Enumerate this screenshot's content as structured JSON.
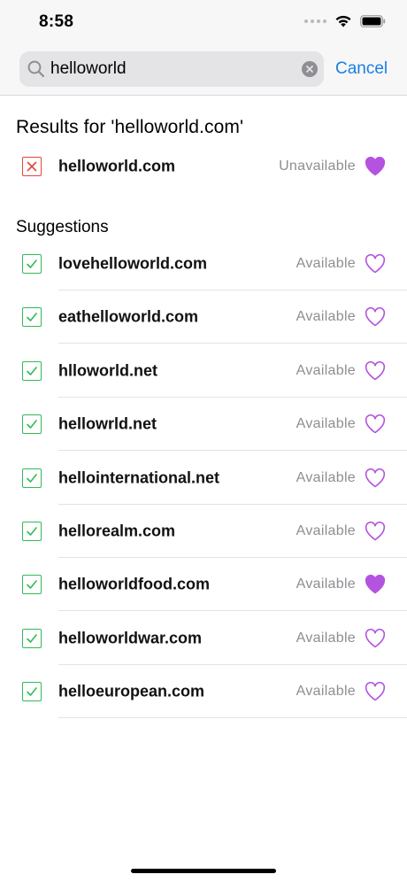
{
  "status_bar": {
    "time": "8:58"
  },
  "search": {
    "query": "helloworld",
    "cancel_label": "Cancel"
  },
  "results": {
    "title": "Results for 'helloworld.com'",
    "item": {
      "domain": "helloworld.com",
      "status": "Unavailable",
      "favorited": true,
      "available": false
    }
  },
  "suggestions": {
    "title": "Suggestions",
    "items": [
      {
        "domain": "lovehelloworld.com",
        "status": "Available",
        "favorited": false
      },
      {
        "domain": "eathelloworld.com",
        "status": "Available",
        "favorited": false
      },
      {
        "domain": "hlloworld.net",
        "status": "Available",
        "favorited": false
      },
      {
        "domain": "hellowrld.net",
        "status": "Available",
        "favorited": false
      },
      {
        "domain": "hellointernational.net",
        "status": "Available",
        "favorited": false
      },
      {
        "domain": "hellorealm.com",
        "status": "Available",
        "favorited": false
      },
      {
        "domain": "helloworldfood.com",
        "status": "Available",
        "favorited": true
      },
      {
        "domain": "helloworldwar.com",
        "status": "Available",
        "favorited": false
      },
      {
        "domain": "helloeuropean.com",
        "status": "Available",
        "favorited": false
      }
    ]
  },
  "colors": {
    "accent": "#1a7fe0",
    "available_check": "#2fbb55",
    "unavailable_check": "#e5453a",
    "heart": "#b453e0"
  }
}
